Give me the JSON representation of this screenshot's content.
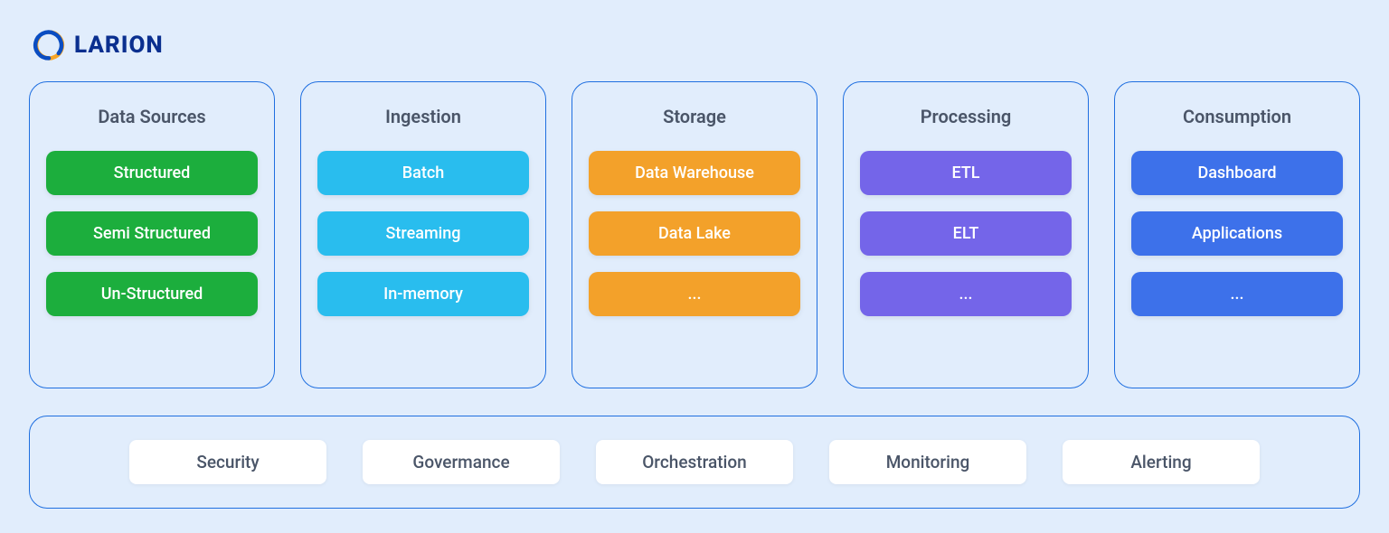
{
  "brand": {
    "name": "LARION"
  },
  "columns": [
    {
      "title": "Data Sources",
      "color": "green",
      "items": [
        "Structured",
        "Semi Structured",
        "Un-Structured"
      ]
    },
    {
      "title": "Ingestion",
      "color": "sky",
      "items": [
        "Batch",
        "Streaming",
        "In-memory"
      ]
    },
    {
      "title": "Storage",
      "color": "orange",
      "items": [
        "Data Warehouse",
        "Data Lake",
        "..."
      ]
    },
    {
      "title": "Processing",
      "color": "purple",
      "items": [
        "ETL",
        "ELT",
        "..."
      ]
    },
    {
      "title": "Consumption",
      "color": "blue",
      "items": [
        "Dashboard",
        "Applications",
        "..."
      ]
    }
  ],
  "footer": [
    "Security",
    "Govermance",
    "Orchestration",
    "Monitoring",
    "Alerting"
  ]
}
